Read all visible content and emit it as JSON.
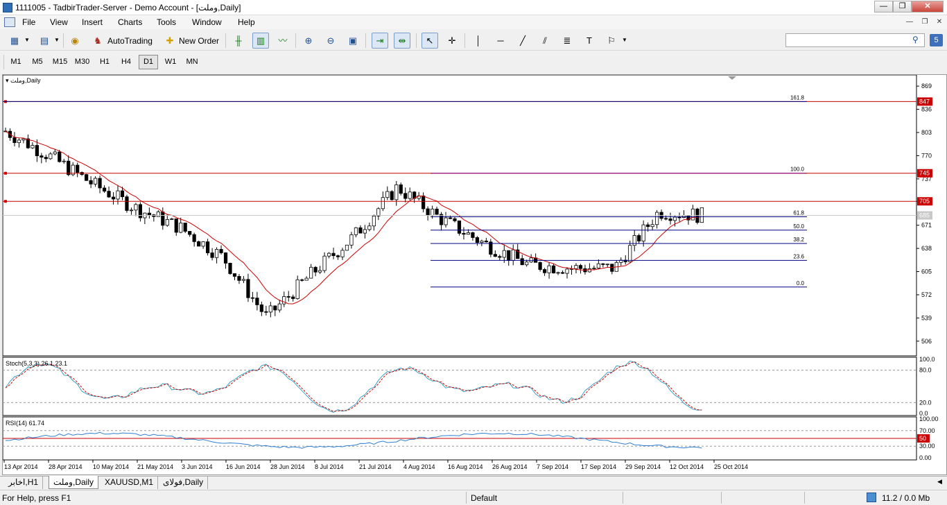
{
  "window": {
    "title": "1111005 - TadbirTrader-Server - Demo Account - [وملت,Daily]"
  },
  "menu": [
    "File",
    "View",
    "Insert",
    "Charts",
    "Tools",
    "Window",
    "Help"
  ],
  "toolbar": {
    "autotrading_label": "AutoTrading",
    "new_order_label": "New Order",
    "notifications_count": "5"
  },
  "timeframes": [
    "M1",
    "M5",
    "M15",
    "M30",
    "H1",
    "H4",
    "D1",
    "W1",
    "MN"
  ],
  "active_timeframe": "D1",
  "chart": {
    "symbol_label": "وملت,Daily",
    "price_ticks": [
      "869",
      "836",
      "803",
      "770",
      "737",
      "705",
      "671",
      "638",
      "605",
      "572",
      "539",
      "506"
    ],
    "price_range": [
      490,
      880
    ],
    "horizontal_lines": [
      {
        "price": 847,
        "label": "847"
      },
      {
        "price": 745,
        "label": "745"
      },
      {
        "price": 705,
        "label": "705"
      }
    ],
    "current_price": {
      "price": 685,
      "label": "685"
    },
    "fibonacci": [
      {
        "level": "161.8",
        "price": 847
      },
      {
        "level": "100.0",
        "price": 745
      },
      {
        "level": "61.8",
        "price": 683
      },
      {
        "level": "50.0",
        "price": 664
      },
      {
        "level": "38.2",
        "price": 645
      },
      {
        "level": "23.6",
        "price": 621
      },
      {
        "level": "0.0",
        "price": 583
      }
    ],
    "date_labels": [
      "13 Apr 2014",
      "28 Apr 2014",
      "10 May 2014",
      "21 May 2014",
      "3 Jun 2014",
      "16 Jun 2014",
      "28 Jun 2014",
      "8 Jul 2014",
      "21 Jul 2014",
      "4 Aug 2014",
      "16 Aug 2014",
      "26 Aug 2014",
      "7 Sep 2014",
      "17 Sep 2014",
      "29 Sep 2014",
      "12 Oct 2014",
      "25 Oct 2014"
    ],
    "colors": {
      "bull": "#ffffff",
      "bear": "#000000",
      "hline": "#cc0000",
      "fib": "#000080",
      "ma": "#cc0000"
    }
  },
  "stoch": {
    "label": "Stoch(5,3,3) 26.1 23.1",
    "ticks": [
      "100.0",
      "80.0",
      "20.0",
      "0.0"
    ],
    "colors": {
      "main": "#3aa0c0",
      "signal": "#cc0000"
    }
  },
  "rsi": {
    "label": "RSI(14) 61.74",
    "ticks": [
      "100.00",
      "70.00",
      "50",
      "30.00",
      "0.00"
    ],
    "colors": {
      "line": "#2f7fd0",
      "level": "#cc0000"
    }
  },
  "chart_data": {
    "type": "candlestick",
    "x": [
      "13 Apr 2014",
      "28 Apr 2014",
      "10 May 2014",
      "21 May 2014",
      "3 Jun 2014",
      "16 Jun 2014",
      "28 Jun 2014",
      "8 Jul 2014",
      "21 Jul 2014",
      "4 Aug 2014",
      "16 Aug 2014",
      "26 Aug 2014",
      "7 Sep 2014",
      "17 Sep 2014",
      "29 Sep 2014",
      "12 Oct 2014",
      "25 Oct 2014"
    ],
    "closes": [
      805,
      770,
      730,
      695,
      668,
      625,
      540,
      600,
      655,
      725,
      680,
      645,
      615,
      610,
      610,
      690,
      685
    ],
    "ylim": [
      490,
      880
    ]
  },
  "tabs": [
    "اخابر,H1",
    "وملت,Daily",
    "XAUUSD,M1",
    "فولای,Daily"
  ],
  "active_tab": "وملت,Daily",
  "status": {
    "help": "For Help, press F1",
    "profile": "Default",
    "traffic": "11.2 / 0.0 Mb"
  }
}
